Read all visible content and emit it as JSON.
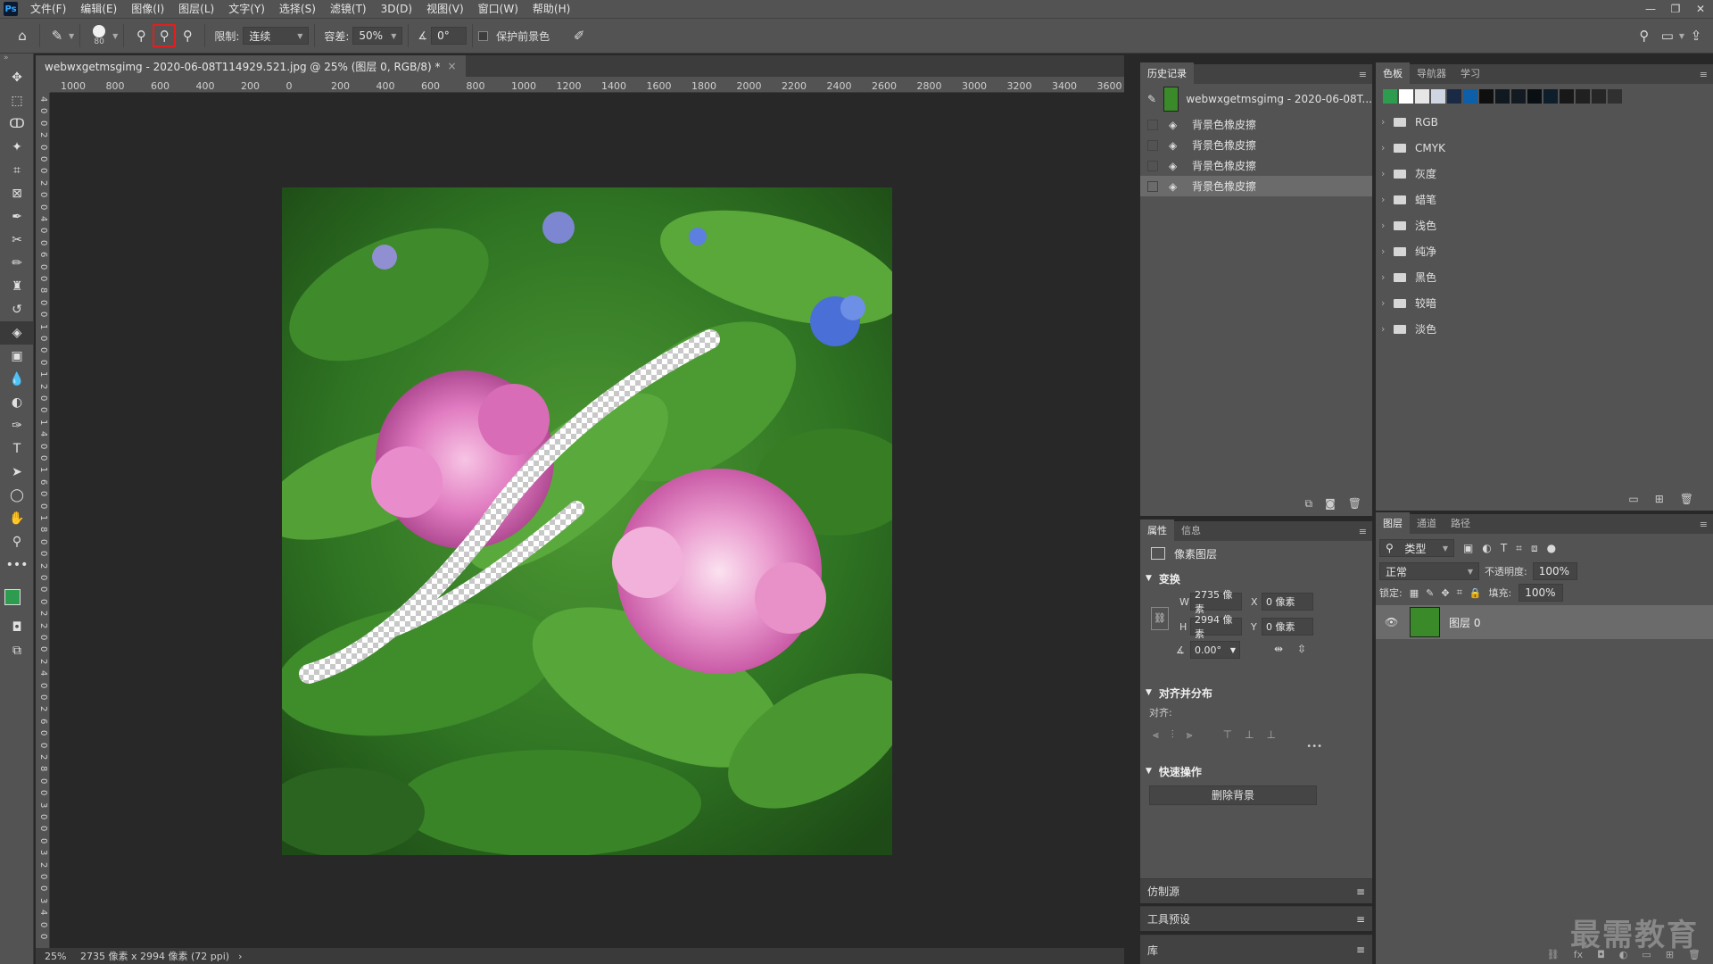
{
  "menubar": {
    "logo": "Ps",
    "items": [
      "文件(F)",
      "编辑(E)",
      "图像(I)",
      "图层(L)",
      "文字(Y)",
      "选择(S)",
      "滤镜(T)",
      "3D(D)",
      "视图(V)",
      "窗口(W)",
      "帮助(H)"
    ],
    "controls": [
      "—",
      "❐",
      "✕"
    ]
  },
  "options": {
    "brush_size": "80",
    "limit_label": "限制:",
    "limit_value": "连续",
    "tolerance_label": "容差:",
    "tolerance_value": "50%",
    "angle_value": "0°",
    "protect_label": "保护前景色"
  },
  "document": {
    "tab_title": "webwxgetmsgimg - 2020-06-08T114929.521.jpg @ 25% (图层 0, RGB/8) *",
    "close": "×",
    "ruler_h": [
      "1000",
      "800",
      "600",
      "400",
      "200",
      "0",
      "200",
      "400",
      "600",
      "800",
      "1000",
      "1200",
      "1400",
      "1600",
      "1800",
      "2000",
      "2200",
      "2400",
      "2600",
      "2800",
      "3000",
      "3200",
      "3400",
      "3600"
    ],
    "ruler_v": [
      "4",
      "0",
      "0",
      "2",
      "0",
      "0",
      "0",
      "2",
      "0",
      "0",
      "4",
      "0",
      "0",
      "6",
      "0",
      "0",
      "8",
      "0",
      "0",
      "1",
      "0",
      "0",
      "0",
      "1",
      "2",
      "0",
      "0",
      "1",
      "4",
      "0",
      "0",
      "1",
      "6",
      "0",
      "0",
      "1",
      "8",
      "0",
      "0",
      "2",
      "0",
      "0",
      "0",
      "2",
      "2",
      "0",
      "0",
      "2",
      "4",
      "0",
      "0",
      "2",
      "6",
      "0",
      "0",
      "2",
      "8",
      "0",
      "0",
      "3",
      "0",
      "0",
      "0",
      "3",
      "2",
      "0",
      "0",
      "3",
      "4",
      "0",
      "0"
    ]
  },
  "status": {
    "zoom": "25%",
    "size": "2735 像素 x 2994 像素 (72 ppi)",
    "arrow": "›"
  },
  "history": {
    "tab": "历史记录",
    "snapshot": "webwxgetmsgimg - 2020-06-08T...",
    "items": [
      "背景色橡皮擦",
      "背景色橡皮擦",
      "背景色橡皮擦",
      "背景色橡皮擦"
    ]
  },
  "swatches": {
    "tabs": [
      "色板",
      "导航器",
      "学习"
    ],
    "colors": [
      "#2e9c4e",
      "#ffffff",
      "#e6e6e6",
      "#cfd6e2",
      "#1a2a44",
      "#0c5fa8",
      "#0f0f0f",
      "#101820",
      "#141a22",
      "#0a0f14",
      "#0e1e2a",
      "#181818",
      "#202020",
      "#262626",
      "#303030"
    ],
    "groups": [
      "RGB",
      "CMYK",
      "灰度",
      "蜡笔",
      "浅色",
      "纯净",
      "黑色",
      "较暗",
      "淡色"
    ]
  },
  "properties": {
    "tabs": [
      "属性",
      "信息"
    ],
    "layer_type": "像素图层",
    "transform_label": "变换",
    "w_label": "W",
    "w_value": "2735 像素",
    "x_label": "X",
    "x_value": "0 像素",
    "h_label": "H",
    "h_value": "2994 像素",
    "y_label": "Y",
    "y_value": "0 像素",
    "angle_value": "0.00°",
    "align_label": "对齐并分布",
    "align_sub": "对齐:",
    "quick_label": "快速操作",
    "remove_bg": "删除背景",
    "more": "•••"
  },
  "collapsed": [
    "仿制源",
    "工具预设",
    "库"
  ],
  "layers": {
    "tabs": [
      "图层",
      "通道",
      "路径"
    ],
    "filter_label": "类型",
    "blend_mode": "正常",
    "opacity_label": "不透明度:",
    "opacity_value": "100%",
    "lock_label": "锁定:",
    "fill_label": "填充:",
    "fill_value": "100%",
    "layer_name": "图层 0"
  },
  "watermark": "最需教育"
}
